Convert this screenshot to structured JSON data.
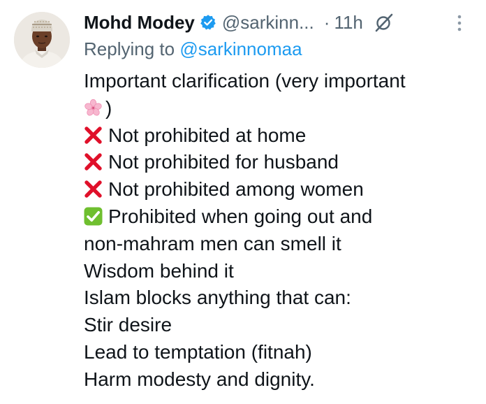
{
  "author": {
    "name": "Mohd Modey",
    "handle": "@sarkinn...",
    "separator": "·",
    "time": "11h"
  },
  "reply": {
    "prefix": "Replying to ",
    "mention": "@sarkinnomaa"
  },
  "body": {
    "line1": "Important clarification (very important",
    "line2_close": ")",
    "not_home": "Not prohibited at home",
    "not_husband": "Not prohibited for husband",
    "not_women": "Not prohibited among women",
    "prohibited_going_out": "Prohibited when going out and",
    "non_mahram": "non-mahram men can smell it",
    "wisdom": "Wisdom behind it",
    "islam_blocks": "Islam blocks anything that can:",
    "stir": "Stir desire",
    "lead": "Lead to temptation (fitnah)",
    "harm": "Harm modesty and dignity."
  },
  "icons": {
    "verified": "verified-badge-icon",
    "grok": "grok-icon",
    "more": "more-options-icon",
    "flower": "cherry-blossom-emoji",
    "cross": "cross-mark-emoji",
    "check": "check-mark-emoji"
  },
  "colors": {
    "text": "#0f1419",
    "muted": "#536471",
    "link": "#1d9bf0",
    "cross": "#e0102a",
    "check": "#6fbf2f"
  }
}
